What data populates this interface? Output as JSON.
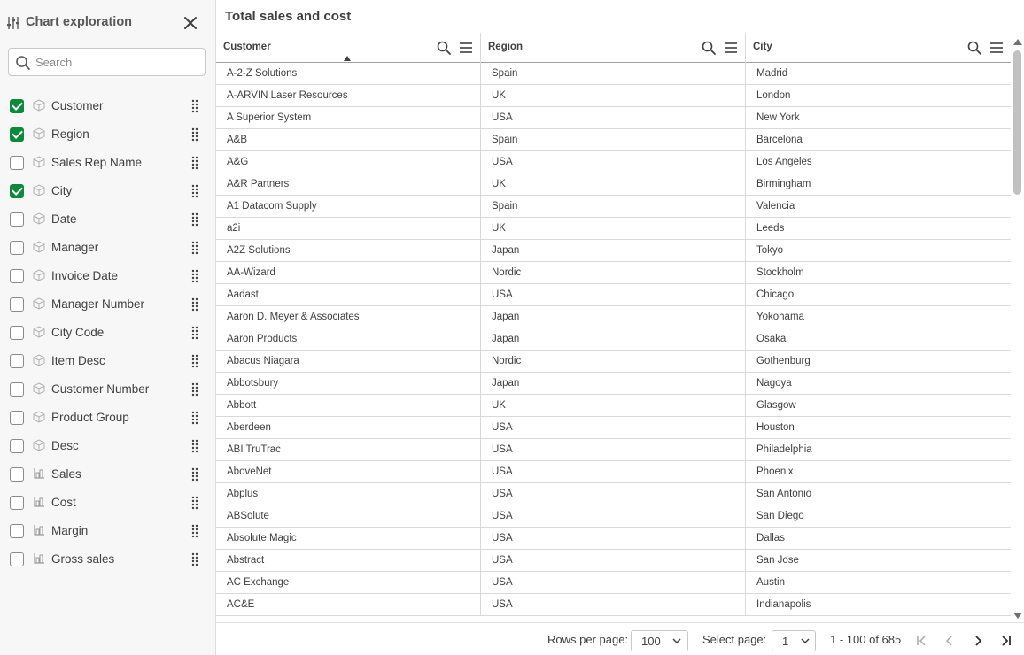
{
  "sidebar": {
    "title": "Chart exploration",
    "search_placeholder": "Search",
    "fields": [
      {
        "label": "Customer",
        "checked": true,
        "type": "dimension"
      },
      {
        "label": "Region",
        "checked": true,
        "type": "dimension"
      },
      {
        "label": "Sales Rep Name",
        "checked": false,
        "type": "dimension"
      },
      {
        "label": "City",
        "checked": true,
        "type": "dimension"
      },
      {
        "label": "Date",
        "checked": false,
        "type": "dimension"
      },
      {
        "label": "Manager",
        "checked": false,
        "type": "dimension"
      },
      {
        "label": "Invoice Date",
        "checked": false,
        "type": "dimension"
      },
      {
        "label": "Manager Number",
        "checked": false,
        "type": "dimension"
      },
      {
        "label": "City Code",
        "checked": false,
        "type": "dimension"
      },
      {
        "label": "Item Desc",
        "checked": false,
        "type": "dimension"
      },
      {
        "label": "Customer Number",
        "checked": false,
        "type": "dimension"
      },
      {
        "label": "Product Group",
        "checked": false,
        "type": "dimension"
      },
      {
        "label": "Desc",
        "checked": false,
        "type": "dimension"
      },
      {
        "label": "Sales",
        "checked": false,
        "type": "measure"
      },
      {
        "label": "Cost",
        "checked": false,
        "type": "measure"
      },
      {
        "label": "Margin",
        "checked": false,
        "type": "measure"
      },
      {
        "label": "Gross sales",
        "checked": false,
        "type": "measure"
      }
    ]
  },
  "table": {
    "title": "Total sales and cost",
    "columns": [
      "Customer",
      "Region",
      "City"
    ],
    "sorted_column": "Customer",
    "rows": [
      [
        "A-2-Z Solutions",
        "Spain",
        "Madrid"
      ],
      [
        "A-ARVIN Laser Resources",
        "UK",
        "London"
      ],
      [
        "A Superior System",
        "USA",
        "New York"
      ],
      [
        "A&B",
        "Spain",
        "Barcelona"
      ],
      [
        "A&G",
        "USA",
        "Los Angeles"
      ],
      [
        "A&R Partners",
        "UK",
        "Birmingham"
      ],
      [
        "A1 Datacom Supply",
        "Spain",
        "Valencia"
      ],
      [
        "a2i",
        "UK",
        "Leeds"
      ],
      [
        "A2Z Solutions",
        "Japan",
        "Tokyo"
      ],
      [
        "AA-Wizard",
        "Nordic",
        "Stockholm"
      ],
      [
        "Aadast",
        "USA",
        "Chicago"
      ],
      [
        "Aaron D. Meyer & Associates",
        "Japan",
        "Yokohama"
      ],
      [
        "Aaron Products",
        "Japan",
        "Osaka"
      ],
      [
        "Abacus Niagara",
        "Nordic",
        "Gothenburg"
      ],
      [
        "Abbotsbury",
        "Japan",
        "Nagoya"
      ],
      [
        "Abbott",
        "UK",
        "Glasgow"
      ],
      [
        "Aberdeen",
        "USA",
        "Houston"
      ],
      [
        "ABI TruTrac",
        "USA",
        "Philadelphia"
      ],
      [
        "AboveNet",
        "USA",
        "Phoenix"
      ],
      [
        "Abplus",
        "USA",
        "San Antonio"
      ],
      [
        "ABSolute",
        "USA",
        "San Diego"
      ],
      [
        "Absolute Magic",
        "USA",
        "Dallas"
      ],
      [
        "Abstract",
        "USA",
        "San Jose"
      ],
      [
        "AC Exchange",
        "USA",
        "Austin"
      ],
      [
        "AC&E",
        "USA",
        "Indianapolis"
      ]
    ]
  },
  "footer": {
    "rows_per_page_label": "Rows per page:",
    "rows_per_page_value": "100",
    "select_page_label": "Select page:",
    "select_page_value": "1",
    "range_text": "1 - 100 of 685"
  },
  "colors": {
    "checked": "#0a8a3a",
    "sidebar_bg": "#f7f7f7"
  }
}
